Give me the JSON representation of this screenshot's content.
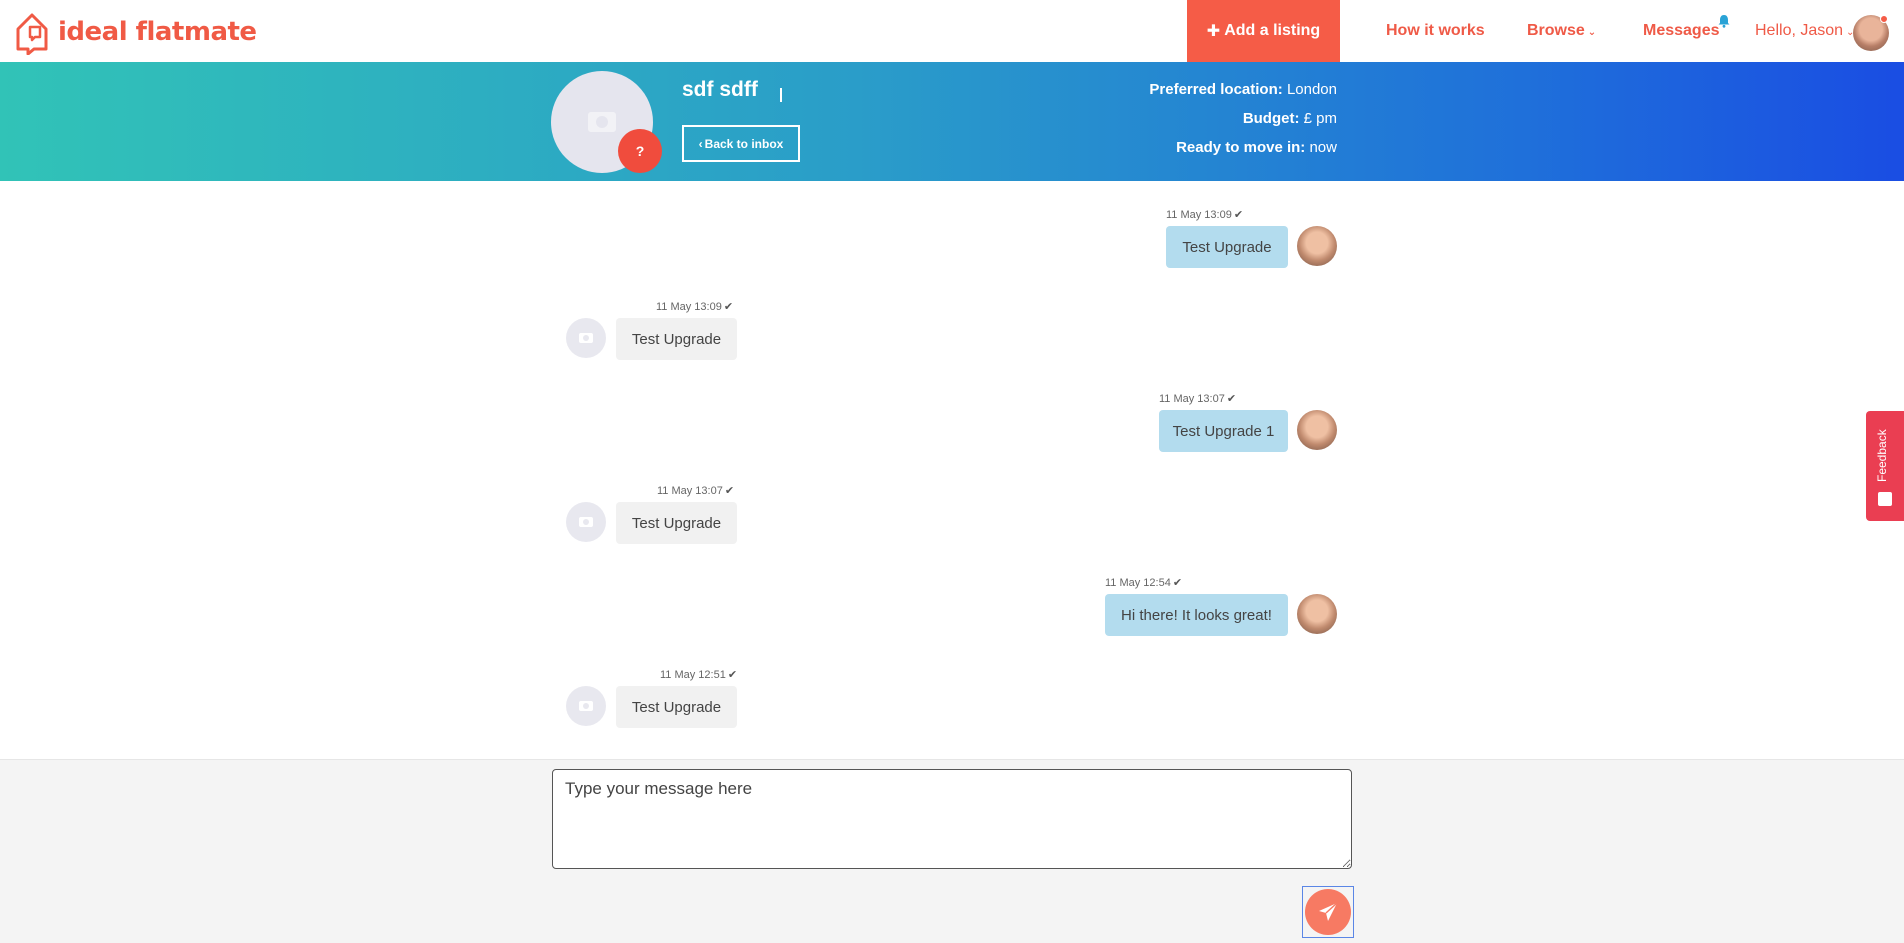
{
  "brand": {
    "name": "ideal flatmate",
    "color": "#f05a45"
  },
  "nav": {
    "add_listing": "Add a listing",
    "how_it_works": "How it works",
    "browse": "Browse",
    "messages": "Messages",
    "greeting": "Hello, Jason"
  },
  "profile": {
    "name": "sdf sdff",
    "back_label": "Back to inbox",
    "badge": "?",
    "preferred_location_label": "Preferred location:",
    "preferred_location_value": "London",
    "budget_label": "Budget:",
    "budget_value": "£ pm",
    "move_in_label": "Ready to move in:",
    "move_in_value": "now"
  },
  "messages": [
    {
      "direction": "out",
      "time": "11 May 13:09",
      "text": "Test Upgrade"
    },
    {
      "direction": "in",
      "time": "11 May 13:09",
      "text": "Test Upgrade"
    },
    {
      "direction": "out",
      "time": "11 May 13:07",
      "text": "Test Upgrade 1"
    },
    {
      "direction": "in",
      "time": "11 May 13:07",
      "text": "Test Upgrade"
    },
    {
      "direction": "out",
      "time": "11 May 12:54",
      "text": "Hi there! It looks great!"
    },
    {
      "direction": "in",
      "time": "11 May 12:51",
      "text": "Test Upgrade"
    }
  ],
  "composer": {
    "placeholder": "Type your message here"
  },
  "feedback": {
    "label": "Feedback"
  },
  "colors": {
    "accent": "#f55c47",
    "bubble_out": "#b3dcee",
    "bubble_in": "#f1f1f1",
    "band_start": "#31c3b7",
    "band_end": "#1a4de3"
  }
}
